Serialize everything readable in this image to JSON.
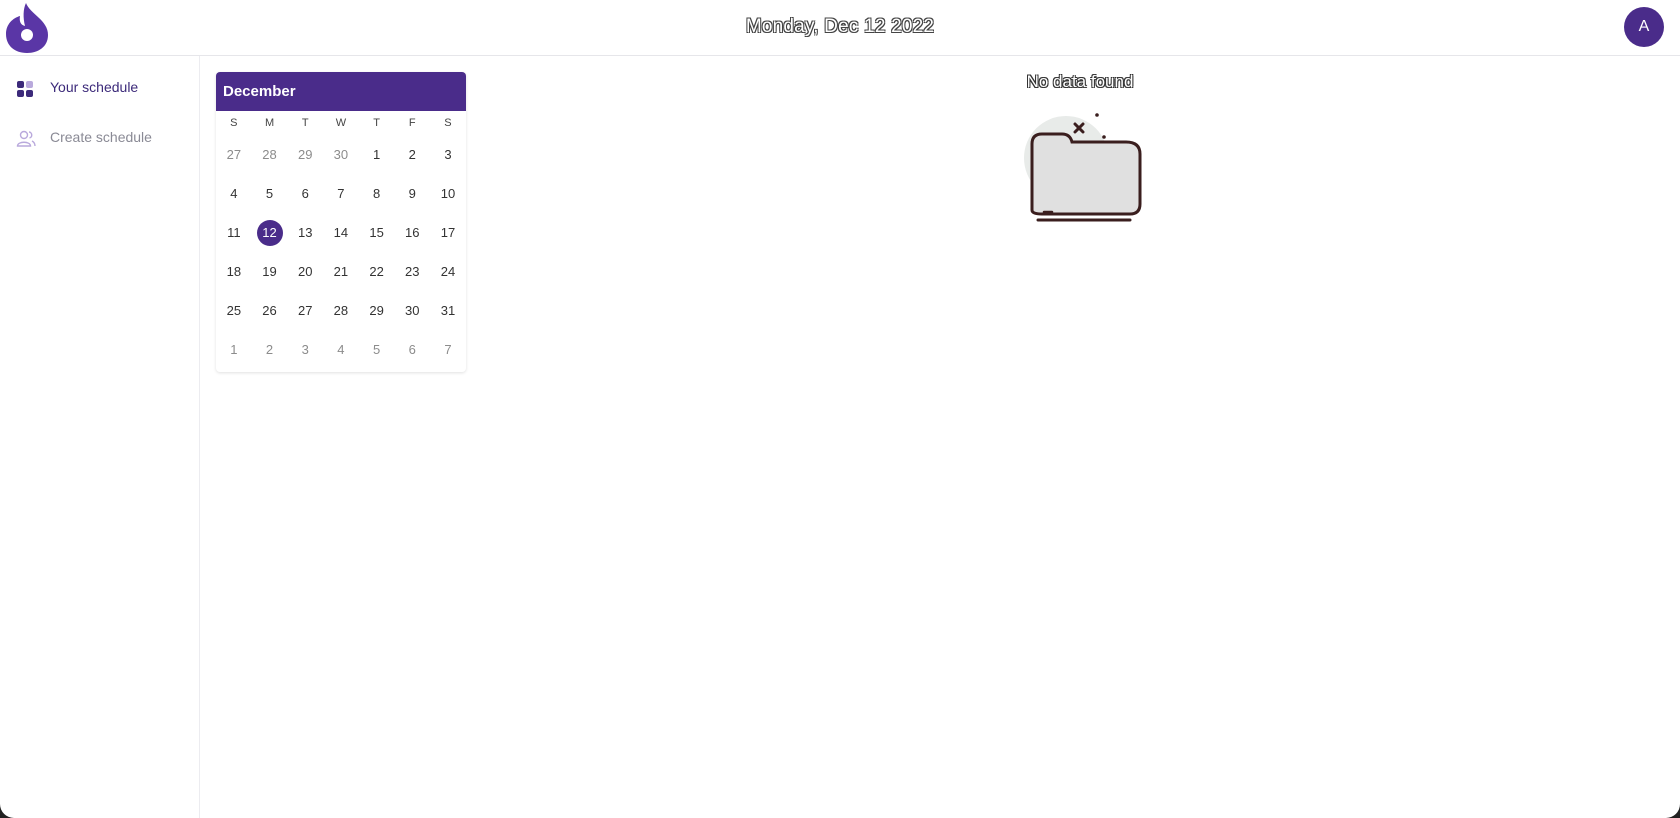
{
  "header": {
    "date": "Monday, Dec 12 2022",
    "avatar_initial": "A",
    "logo_icon": "flame-logo-icon",
    "brand_color": "#4a2c8a"
  },
  "sidebar": {
    "items": [
      {
        "label": "Your schedule",
        "icon": "grid-apps-icon",
        "active": true
      },
      {
        "label": "Create schedule",
        "icon": "users-icon",
        "active": false
      }
    ]
  },
  "calendar": {
    "month": "December",
    "weekdays": [
      "S",
      "M",
      "T",
      "W",
      "T",
      "F",
      "S"
    ],
    "weeks": [
      [
        "27",
        "28",
        "29",
        "30",
        "1",
        "2",
        "3"
      ],
      [
        "4",
        "5",
        "6",
        "7",
        "8",
        "9",
        "10"
      ],
      [
        "11",
        "12",
        "13",
        "14",
        "15",
        "16",
        "17"
      ],
      [
        "18",
        "19",
        "20",
        "21",
        "22",
        "23",
        "24"
      ],
      [
        "25",
        "26",
        "27",
        "28",
        "29",
        "30",
        "31"
      ],
      [
        "1",
        "2",
        "3",
        "4",
        "5",
        "6",
        "7"
      ]
    ],
    "selected_day": "12"
  },
  "main": {
    "empty_text": "No data found",
    "empty_icon": "empty-folder-icon"
  }
}
